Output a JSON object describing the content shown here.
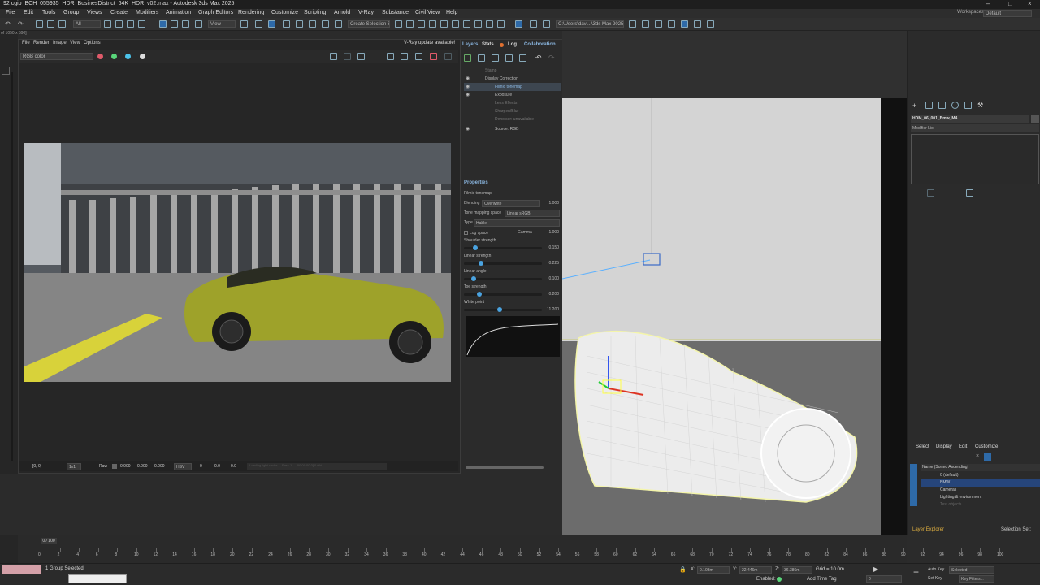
{
  "window": {
    "title": "92 cgib_BCH_055935_HDR_BusinesDistrict_64K_HDR_v02.max - Autodesk 3ds Max 2025",
    "minimize": "–",
    "maximize": "□",
    "close": "×"
  },
  "menu": [
    "File",
    "Edit",
    "Tools",
    "Group",
    "Views",
    "Create",
    "Modifiers",
    "Animation",
    "Graph Editors",
    "Rendering",
    "Customize",
    "Scripting",
    "Arnold",
    "V-Ray",
    "Substance",
    "Civil View",
    "Help"
  ],
  "workspaces": {
    "label": "Workspaces:",
    "value": "Default"
  },
  "toolbar": {
    "filter": "All",
    "view": "View",
    "selection_set": "Create Selection Se",
    "project_path": "C:\\Users\\davi...\\3ds Max 2025"
  },
  "leftstrip": {
    "coords": "of 1050 x 590]"
  },
  "vfb": {
    "menu": [
      "File",
      "Render",
      "Image",
      "View",
      "Options"
    ],
    "update_notice": "V-Ray update available!",
    "channel": "RGB color",
    "status": {
      "coords": "[0, 0]",
      "zoom": "1x1",
      "raw_label": "Raw",
      "r": "0.000",
      "g": "0.000",
      "b": "0.000",
      "space": "HSV",
      "h": "0",
      "s": "0.0",
      "v": "0.0",
      "message": "Loading light cache ... Pass 1 ... [00:00:00.0] 0.0%"
    }
  },
  "layers_panel": {
    "tabs": [
      "Layers",
      "Stats",
      "Log",
      "Collaboration"
    ],
    "layers": [
      {
        "label": "Stamp",
        "dim": true,
        "indent": 1
      },
      {
        "label": "Display Correction",
        "dim": false,
        "indent": 1
      },
      {
        "label": "Filmic tonemap",
        "dim": false,
        "indent": 2,
        "selected": true
      },
      {
        "label": "Exposure",
        "dim": false,
        "indent": 2
      },
      {
        "label": "Lens Effects",
        "dim": true,
        "indent": 2
      },
      {
        "label": "Sharpen/Blur",
        "dim": true,
        "indent": 2
      },
      {
        "label": "Denoiser: unavailable",
        "dim": true,
        "indent": 2
      },
      {
        "label": "Source: RGB",
        "dim": false,
        "indent": 2
      }
    ],
    "properties_title": "Properties",
    "layer_name": "Filmic tonemap",
    "blending_label": "Blending",
    "blending_value": "Overwrite",
    "blending_amount": "1.000",
    "tonemap_space_label": "Tone mapping space",
    "tonemap_space_value": "Linear sRGB",
    "type_label": "Type",
    "type_value": "Hable",
    "log_space_label": "Log space",
    "gamma_label": "Gamma",
    "gamma_value": "1.000",
    "sliders": [
      {
        "label": "Shoulder strength",
        "value": "0.150",
        "pos": 0.12
      },
      {
        "label": "Linear strength",
        "value": "0.225",
        "pos": 0.2
      },
      {
        "label": "Linear angle",
        "value": "0.100",
        "pos": 0.1
      },
      {
        "label": "Toe strength",
        "value": "0.200",
        "pos": 0.18
      },
      {
        "label": "White point",
        "value": "11.200",
        "pos": 0.45
      }
    ]
  },
  "command_panel": {
    "object_name": "HDM_06_001_Bmw_M4",
    "modifier_list": "Modifier List"
  },
  "scene_explorer": {
    "menu": [
      "Select",
      "Display",
      "Edit",
      "Customize"
    ],
    "header": "Name (Sorted Ascending)",
    "items": [
      {
        "label": "0 (default)",
        "selected": false
      },
      {
        "label": "BMW",
        "selected": true
      },
      {
        "label": "Cameras",
        "selected": false
      },
      {
        "label": "Lighting & environment",
        "selected": false
      },
      {
        "label": "Test objects",
        "selected": false
      }
    ],
    "footer_label": "Layer Explorer",
    "selection_set": "Selection Set:"
  },
  "timeline": {
    "frame_counter": "0 / 100",
    "ticks": [
      "0",
      "2",
      "4",
      "6",
      "8",
      "10",
      "12",
      "14",
      "16",
      "18",
      "20",
      "22",
      "24",
      "26",
      "28",
      "30",
      "32",
      "34",
      "36",
      "38",
      "40",
      "42",
      "44",
      "46",
      "48",
      "50",
      "52",
      "54",
      "56",
      "58",
      "60",
      "62",
      "64",
      "66",
      "68",
      "70",
      "72",
      "74",
      "76",
      "78",
      "80",
      "82",
      "84",
      "86",
      "88",
      "90",
      "92",
      "94",
      "96",
      "98",
      "100"
    ]
  },
  "statusbar": {
    "selected": "1 Group Selected",
    "x_label": "X:",
    "x_value": "0.103m",
    "y_label": "Y:",
    "y_value": "22.446m",
    "z_label": "Z:",
    "z_value": "36.386m",
    "grid": "Grid = 10.0m",
    "enabled": "Enabled:",
    "add_time_tag": "Add Time Tag",
    "auto_key": "Auto Key",
    "set_key": "Set Key",
    "key_mode": "Selected",
    "key_filters": "Key Filters...",
    "frame": "0"
  }
}
